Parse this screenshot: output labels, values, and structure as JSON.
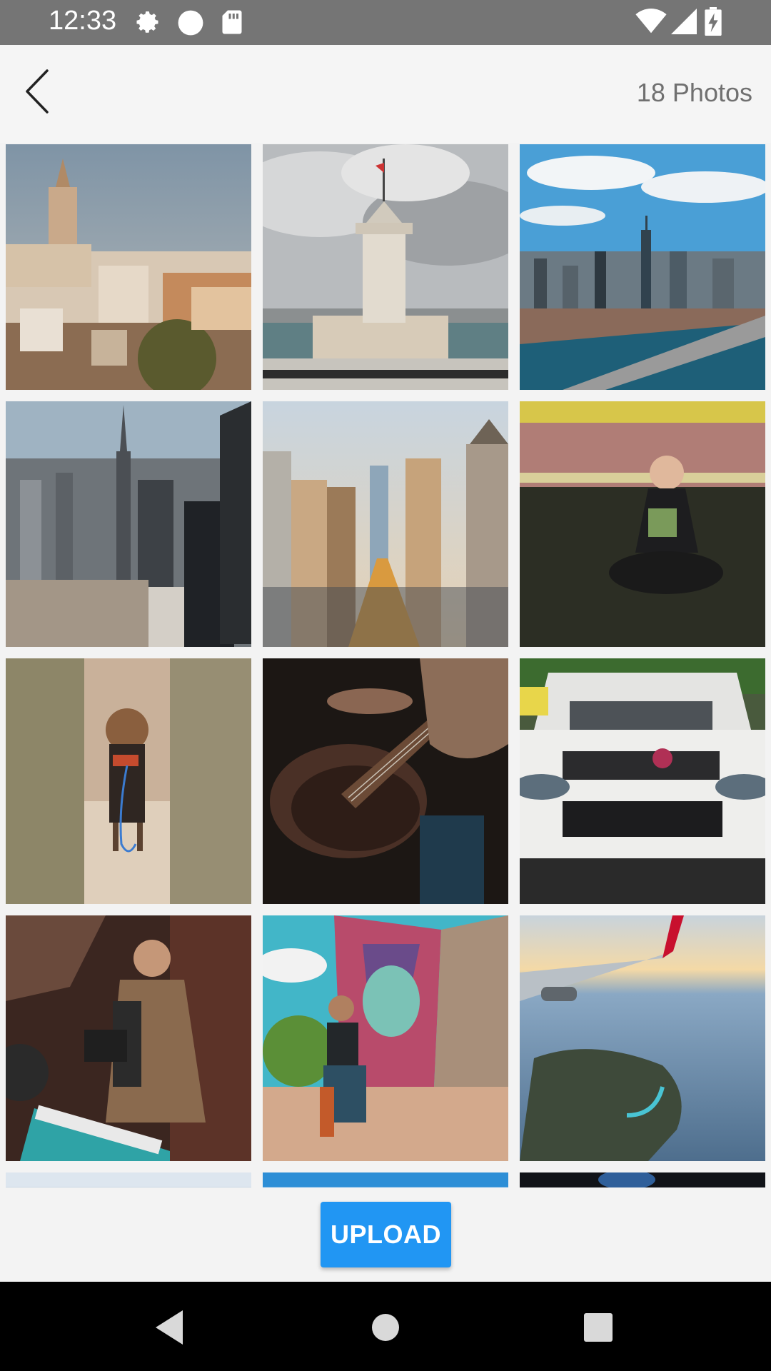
{
  "status_bar": {
    "time": "12:33",
    "icons": [
      "gear-icon",
      "circle-icon",
      "sd-card-icon",
      "wifi-icon",
      "signal-icon",
      "battery-charging-icon"
    ]
  },
  "header": {
    "back_icon": "chevron-left-icon",
    "photo_count": "18 Photos"
  },
  "photos": [
    {
      "name": "photo-galata-tower",
      "scene": "galata"
    },
    {
      "name": "photo-maiden-tower",
      "scene": "maiden"
    },
    {
      "name": "photo-skyline-river",
      "scene": "skyline"
    },
    {
      "name": "photo-empire-state",
      "scene": "empire"
    },
    {
      "name": "photo-city-street",
      "scene": "street"
    },
    {
      "name": "photo-person-sitting",
      "scene": "person"
    },
    {
      "name": "photo-dog-field",
      "scene": "dog"
    },
    {
      "name": "photo-bass-guitar",
      "scene": "guitar"
    },
    {
      "name": "photo-white-car",
      "scene": "car"
    },
    {
      "name": "photo-keyboard-player",
      "scene": "keyboard"
    },
    {
      "name": "photo-mural-street",
      "scene": "mural"
    },
    {
      "name": "photo-airplane-wing",
      "scene": "plane"
    },
    {
      "name": "photo-partial-1",
      "scene": "sky"
    },
    {
      "name": "photo-partial-2",
      "scene": "blue"
    },
    {
      "name": "photo-partial-3",
      "scene": "dark"
    }
  ],
  "actions": {
    "upload_label": "UPLOAD"
  },
  "nav": {
    "icons": [
      "back-triangle-icon",
      "home-circle-icon",
      "recents-square-icon"
    ]
  },
  "colors": {
    "accent": "#2196f3",
    "status_bar": "#757575"
  }
}
